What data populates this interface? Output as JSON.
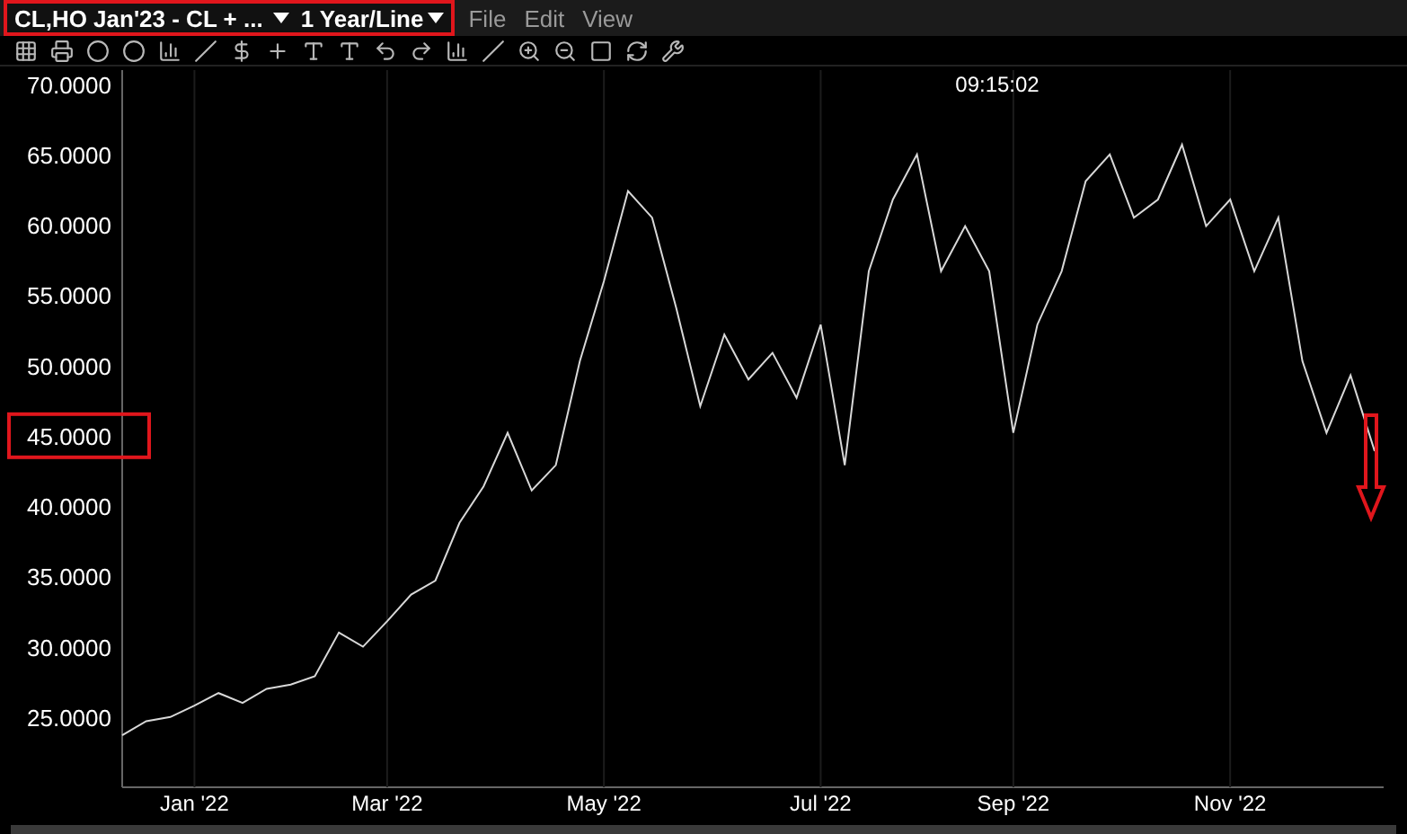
{
  "header": {
    "symbol": "CL,HO Jan'23 - CL + ...",
    "period": "1 Year/Line",
    "menu": [
      {
        "label": "File"
      },
      {
        "label": "Edit"
      },
      {
        "label": "View"
      }
    ]
  },
  "chart": {
    "timestamp": "09:15:02",
    "chart_data": {
      "type": "line",
      "grid": true,
      "ylim": [
        20,
        71
      ],
      "categories": [
        null,
        null,
        null,
        "Jan '22",
        null,
        null,
        null,
        null,
        null,
        null,
        null,
        "Mar '22",
        null,
        null,
        null,
        null,
        null,
        null,
        null,
        null,
        "May '22",
        null,
        null,
        null,
        null,
        null,
        null,
        null,
        null,
        "Jul '22",
        null,
        null,
        null,
        null,
        null,
        null,
        null,
        "Sep '22",
        null,
        null,
        null,
        null,
        null,
        null,
        null,
        null,
        "Nov '22",
        null,
        null,
        null,
        null,
        null,
        null
      ],
      "yticks": [
        {
          "value": 25,
          "label": "25.0000"
        },
        {
          "value": 30,
          "label": "30.0000"
        },
        {
          "value": 35,
          "label": "35.0000"
        },
        {
          "value": 40,
          "label": "40.0000"
        },
        {
          "value": 45,
          "label": "45.0000"
        },
        {
          "value": 50,
          "label": "50.0000"
        },
        {
          "value": 55,
          "label": "55.0000"
        },
        {
          "value": 60,
          "label": "60.0000"
        },
        {
          "value": 65,
          "label": "65.0000"
        },
        {
          "value": 70,
          "label": "70.0000"
        }
      ],
      "series": [
        {
          "color": "#d8d8d8",
          "values": [
            23.7,
            24.7,
            25,
            25.8,
            26.7,
            26,
            27,
            27.3,
            27.9,
            31,
            30,
            31.8,
            33.7,
            34.7,
            38.8,
            41.4,
            45.2,
            41.1,
            42.9,
            50.3,
            56,
            62.4,
            60.5,
            54.1,
            47.1,
            52.2,
            49,
            50.9,
            47.7,
            52.9,
            42.9,
            56.7,
            61.8,
            65,
            56.7,
            59.9,
            56.7,
            45.2,
            52.9,
            56.7,
            63.1,
            65,
            60.5,
            61.8,
            65.7,
            59.9,
            61.8,
            56.7,
            60.5,
            50.3,
            45.2,
            49.3,
            43.9
          ]
        }
      ]
    }
  }
}
